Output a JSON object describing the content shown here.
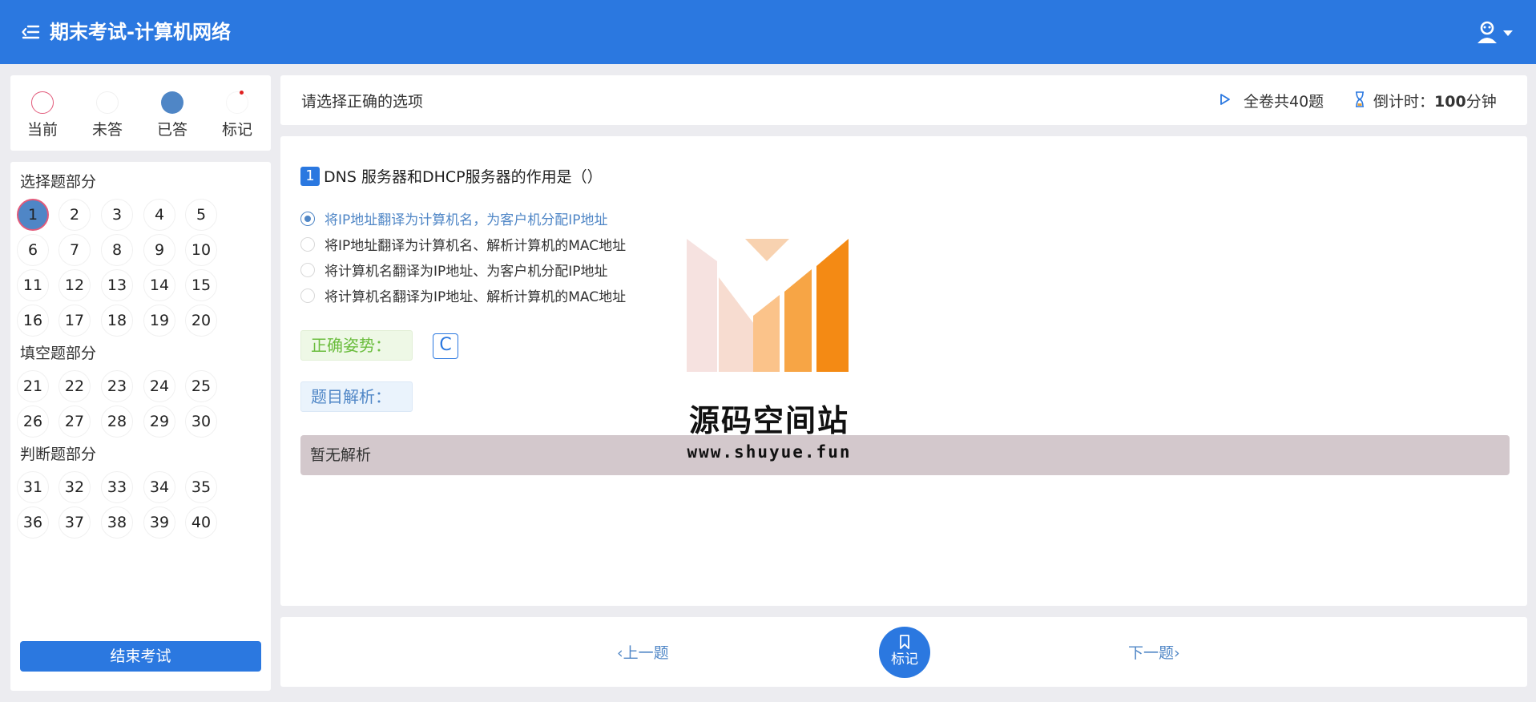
{
  "header": {
    "title": "期末考试-计算机网络"
  },
  "legend": [
    {
      "key": "current",
      "label": "当前"
    },
    {
      "key": "unanswered",
      "label": "未答"
    },
    {
      "key": "answered",
      "label": "已答"
    },
    {
      "key": "marked",
      "label": "标记"
    }
  ],
  "sections": [
    {
      "title": "选择题部分",
      "questions": [
        "1",
        "2",
        "3",
        "4",
        "5",
        "6",
        "7",
        "8",
        "9",
        "10",
        "11",
        "12",
        "13",
        "14",
        "15",
        "16",
        "17",
        "18",
        "19",
        "20"
      ]
    },
    {
      "title": "填空题部分",
      "questions": [
        "21",
        "22",
        "23",
        "24",
        "25",
        "26",
        "27",
        "28",
        "29",
        "30"
      ]
    },
    {
      "title": "判断题部分",
      "questions": [
        "31",
        "32",
        "33",
        "34",
        "35",
        "36",
        "37",
        "38",
        "39",
        "40"
      ]
    }
  ],
  "current_question": "1",
  "finish_label": "结束考试",
  "info": {
    "instruction": "请选择正确的选项",
    "total": "全卷共40题",
    "countdown_prefix": "倒计时：",
    "countdown_value": "100",
    "countdown_unit": "分钟"
  },
  "question": {
    "number": "1",
    "text": "DNS 服务器和DHCP服务器的作用是（）",
    "options": [
      "将IP地址翻译为计算机名，为客户机分配IP地址",
      "将IP地址翻译为计算机名、解析计算机的MAC地址",
      "将计算机名翻译为IP地址、为客户机分配IP地址",
      "将计算机名翻译为IP地址、解析计算机的MAC地址"
    ],
    "selected_index": 0,
    "answer_label": "正确姿势：",
    "answer_value": "C",
    "analysis_label": "题目解析：",
    "analysis_text": "暂无解析"
  },
  "watermark": {
    "name": "源码空间站",
    "url": "www.shuyue.fun"
  },
  "bottom": {
    "prev_label": "上一题",
    "mark_label": "标记",
    "next_label": "下一题"
  },
  "colors": {
    "primary": "#2b78e0",
    "answered": "#4f86c6",
    "current_ring": "#e25a7a",
    "marked_dot": "#e02020"
  }
}
